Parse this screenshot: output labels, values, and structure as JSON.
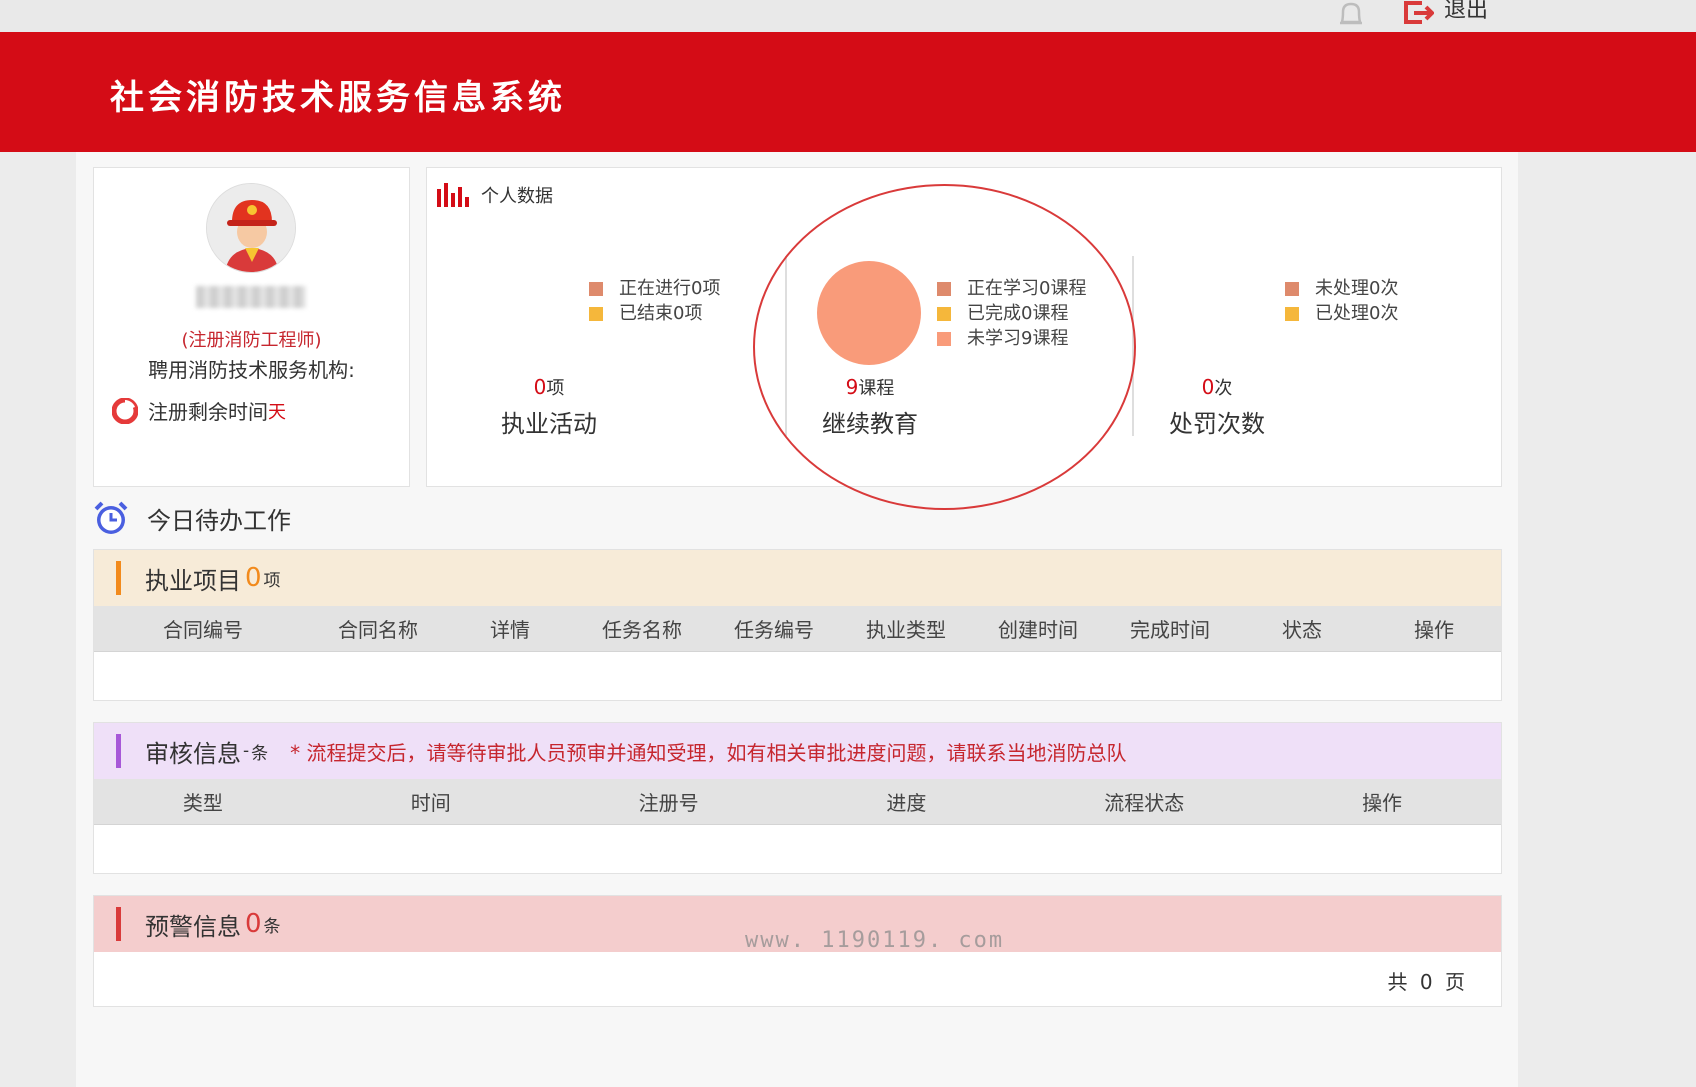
{
  "topbar": {
    "logout_label": "退出"
  },
  "header": {
    "title": "社会消防技术服务信息系统"
  },
  "profile": {
    "role": "(注册消防工程师)",
    "org_label": "聘用消防技术服务机构:",
    "remain_label": "注册剩余时间",
    "remain_unit": "天"
  },
  "stats": {
    "title": "个人数据",
    "groups": [
      {
        "legend": [
          "正在进行0项",
          "已结束0项"
        ],
        "value": "0",
        "unit": "项",
        "label": "执业活动"
      },
      {
        "legend": [
          "正在学习0课程",
          "已完成0课程",
          "未学习9课程"
        ],
        "value": "9",
        "unit": "课程",
        "label": "继续教育"
      },
      {
        "legend": [
          "未处理0次",
          "已处理0次"
        ],
        "value": "0",
        "unit": "次",
        "label": "处罚次数"
      }
    ],
    "colors": {
      "legend_a": "#de8a6c",
      "legend_b": "#f5b73b",
      "legend_c": "#f99b7a"
    }
  },
  "today": {
    "title": "今日待办工作"
  },
  "projects": {
    "title": "执业项目",
    "count": "0",
    "unit": "项",
    "columns": [
      "合同编号",
      "合同名称",
      "详情",
      "任务名称",
      "任务编号",
      "执业类型",
      "创建时间",
      "完成时间",
      "状态",
      "操作"
    ]
  },
  "review": {
    "title": "审核信息",
    "count": "-",
    "unit": "条",
    "notice": "* 流程提交后，请等待审批人员预审并通知受理，如有相关审批进度问题，请联系当地消防总队",
    "columns": [
      "类型",
      "时间",
      "注册号",
      "进度",
      "流程状态",
      "操作"
    ]
  },
  "warning": {
    "title": "预警信息",
    "count": "0",
    "unit": "条",
    "pager": "共 0 页"
  },
  "watermark": "www. 1190119. com"
}
